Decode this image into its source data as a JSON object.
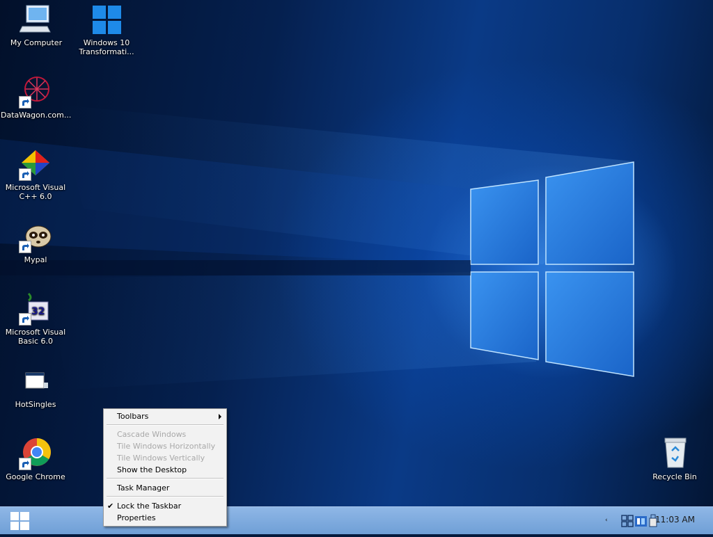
{
  "desktop": {
    "icons": [
      {
        "label": "My Computer",
        "icon": "computer-icon",
        "shortcut": false
      },
      {
        "label": "Windows 10 Transformati...",
        "icon": "windows-logo-icon",
        "shortcut": false
      },
      {
        "label": "DataWagon.com...",
        "icon": "datawagon-icon",
        "shortcut": true
      },
      {
        "label": "Microsoft Visual C++ 6.0",
        "icon": "visual-cpp-icon",
        "shortcut": true
      },
      {
        "label": "Mypal",
        "icon": "mypal-raccoon-icon",
        "shortcut": true
      },
      {
        "label": "Microsoft Visual Basic 6.0",
        "icon": "visual-basic-icon",
        "shortcut": true
      },
      {
        "label": "HotSingles",
        "icon": "hotsingles-icon",
        "shortcut": false
      },
      {
        "label": "Google Chrome",
        "icon": "chrome-icon",
        "shortcut": true
      },
      {
        "label": "Recycle Bin",
        "icon": "recycle-bin-icon",
        "shortcut": false
      }
    ]
  },
  "context_menu": {
    "items": [
      {
        "label": "Toolbars",
        "enabled": true,
        "submenu": true
      },
      {
        "label": "Cascade Windows",
        "enabled": false
      },
      {
        "label": "Tile Windows Horizontally",
        "enabled": false
      },
      {
        "label": "Tile Windows Vertically",
        "enabled": false
      },
      {
        "label": "Show the Desktop",
        "enabled": true
      },
      {
        "label": "Task Manager",
        "enabled": true
      },
      {
        "label": "Lock the Taskbar",
        "enabled": true,
        "checked": true
      },
      {
        "label": "Properties",
        "enabled": true
      }
    ]
  },
  "taskbar": {
    "start_icon": "windows-start-icon",
    "tray_icons": [
      "network-icon",
      "tray-app-icon",
      "usb-drive-icon"
    ],
    "clock": "11:03 AM"
  },
  "colors": {
    "taskbar": "#7aa7dc",
    "menu_bg": "#f2f2f2",
    "desktop": "#0a3a86"
  }
}
